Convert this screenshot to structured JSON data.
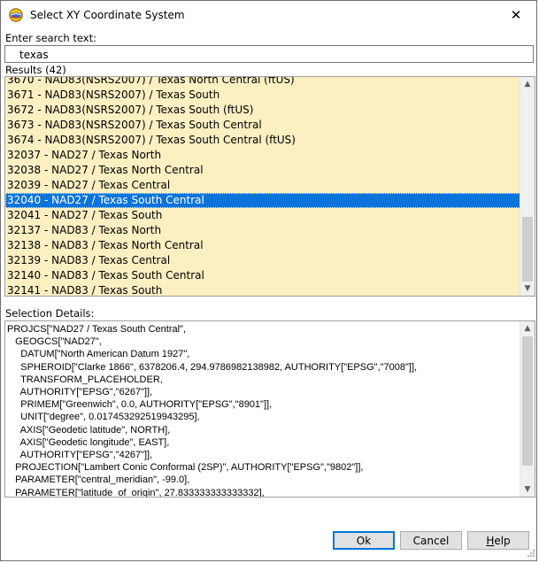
{
  "window": {
    "title": "Select XY Coordinate System",
    "close_glyph": "✕"
  },
  "search": {
    "label": "Enter search text:",
    "value": "texas"
  },
  "results": {
    "label": "Results (42)",
    "items": [
      "3670 - NAD83(NSRS2007) / Texas North Central (ftUS)",
      "3671 - NAD83(NSRS2007) / Texas South",
      "3672 - NAD83(NSRS2007) / Texas South (ftUS)",
      "3673 - NAD83(NSRS2007) / Texas South Central",
      "3674 - NAD83(NSRS2007) / Texas South Central (ftUS)",
      "32037 - NAD27 / Texas North",
      "32038 - NAD27 / Texas North Central",
      "32039 - NAD27 / Texas Central",
      "32040 - NAD27 / Texas South Central",
      "32041 - NAD27 / Texas South",
      "32137 - NAD83 / Texas North",
      "32138 - NAD83 / Texas North Central",
      "32139 - NAD83 / Texas Central",
      "32140 - NAD83 / Texas South Central",
      "32141 - NAD83 / Texas South"
    ],
    "selected_index": 8
  },
  "details": {
    "label": "Selection Details:",
    "text": "PROJCS[\"NAD27 / Texas South Central\",\n   GEOGCS[\"NAD27\",\n     DATUM[\"North American Datum 1927\",\n     SPHEROID[\"Clarke 1866\", 6378206.4, 294.9786982138982, AUTHORITY[\"EPSG\",\"7008\"]],\n     TRANSFORM_PLACEHOLDER,\n     AUTHORITY[\"EPSG\",\"6267\"]],\n     PRIMEM[\"Greenwich\", 0.0, AUTHORITY[\"EPSG\",\"8901\"]],\n     UNIT[\"degree\", 0.017453292519943295],\n     AXIS[\"Geodetic latitude\", NORTH],\n     AXIS[\"Geodetic longitude\", EAST],\n     AUTHORITY[\"EPSG\",\"4267\"]],\n   PROJECTION[\"Lambert Conic Conformal (2SP)\", AUTHORITY[\"EPSG\",\"9802\"]],\n   PARAMETER[\"central_meridian\", -99.0],\n   PARAMETER[\"latitude_of_origin\", 27.833333333333332],"
  },
  "buttons": {
    "ok": "Ok",
    "cancel": "Cancel",
    "help_first": "H",
    "help_rest": "elp"
  },
  "icons": {
    "app": "app-globe-icon",
    "close": "close-icon",
    "scroll_up": "scroll-up-arrow-icon",
    "scroll_down": "scroll-down-arrow-icon"
  },
  "colors": {
    "list_background": "#fcefc2",
    "selection": "#0a74da",
    "default_button_border": "#0078d7"
  }
}
